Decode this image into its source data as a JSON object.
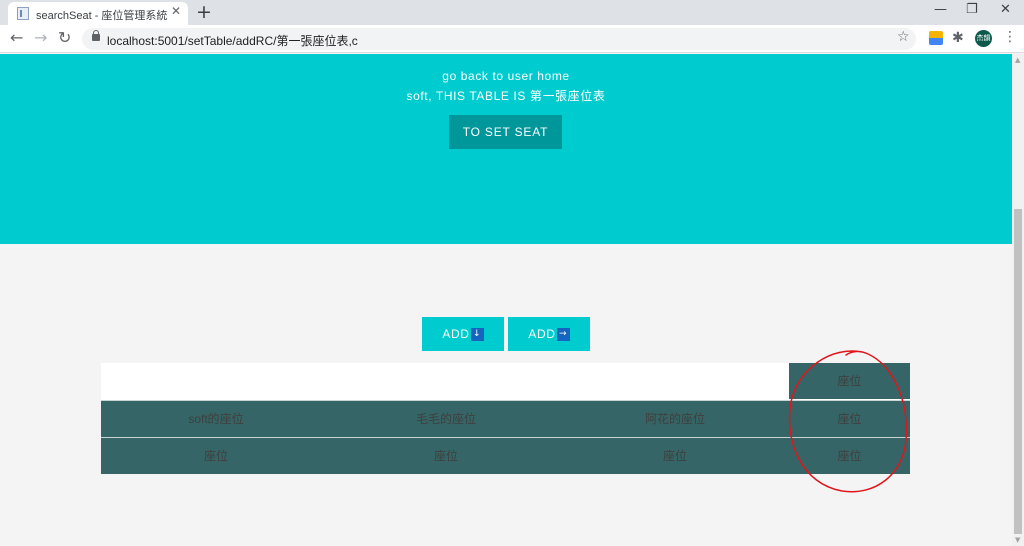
{
  "browser": {
    "tab": {
      "title": "searchSeat - 座位管理系統",
      "close": "✕",
      "favicon": "page-icon"
    },
    "new_tab": "+",
    "window": {
      "minimize": "—",
      "restore": "❐",
      "close": "✕"
    },
    "nav": {
      "back": "←",
      "forward": "→",
      "reload": "↻"
    },
    "url": "localhost:5001/setTable/addRC/第一張座位表,c",
    "star": "☆",
    "puzzle": "✱",
    "avatar": "杰韻",
    "menu": "⋮"
  },
  "hero": {
    "back_link": "go back to user home",
    "table_message": "soft, THIS TABLE IS 第一張座位表",
    "set_seat_button": "TO SET SEAT"
  },
  "add_buttons": [
    {
      "label": "ADD",
      "arrow": "↓"
    },
    {
      "label": "ADD",
      "arrow": "→"
    }
  ],
  "seat_table": {
    "rows": [
      [
        "",
        "",
        "",
        "座位"
      ],
      [
        "soft的座位",
        "毛毛的座位",
        "阿花的座位",
        "座位"
      ],
      [
        "座位",
        "座位",
        "座位",
        "座位"
      ]
    ]
  },
  "colors": {
    "hero": "#00cccf",
    "set_seat_button": "#00979a",
    "table_row": "#356566",
    "annotation": "#e0161a"
  },
  "scrollbar": {
    "up": "▲",
    "down": "▼"
  }
}
